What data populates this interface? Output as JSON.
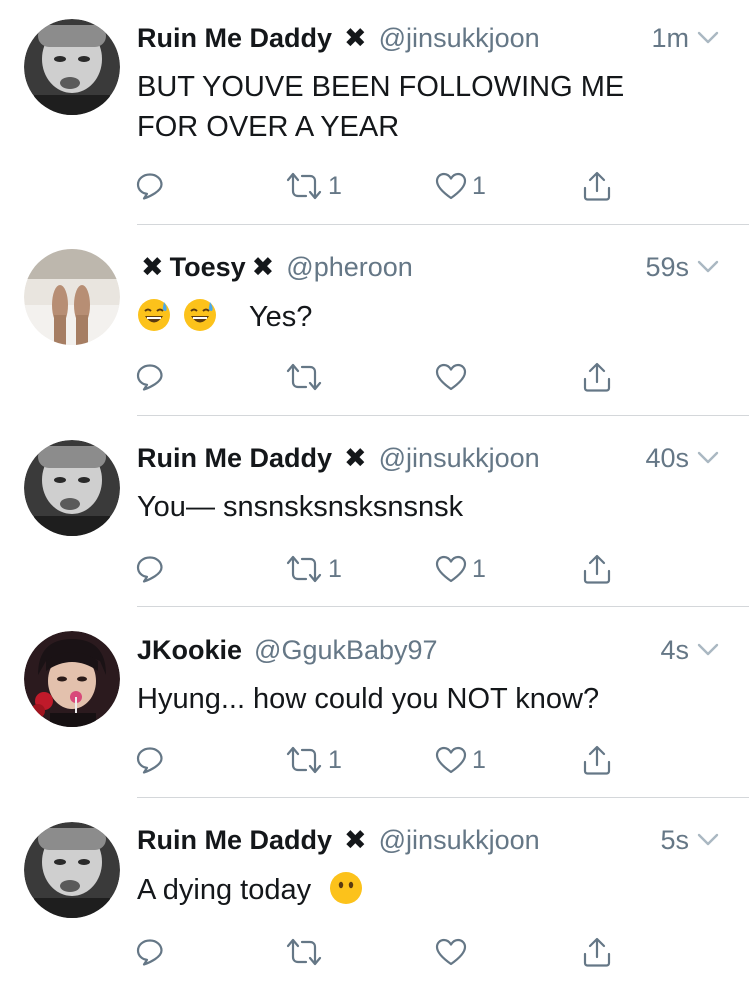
{
  "tweets": [
    {
      "name": "Ruin Me Daddy",
      "lead_x": false,
      "trail_x": true,
      "handle": "@jinsukkjoon",
      "time": "1m",
      "text": "BUT YOUVE BEEN FOLLOWING ME FOR OVER A YEAR",
      "emoji_before": [],
      "emoji_after": "",
      "retweets": "1",
      "likes": "1",
      "avatar": "bw-face"
    },
    {
      "name": "Toesy",
      "lead_x": true,
      "trail_x": true,
      "handle": "@pheroon",
      "time": "59s",
      "text": "Yes?",
      "emoji_before": [
        "sweat-smile-emoji",
        "sweat-smile-emoji"
      ],
      "emoji_after": "",
      "retweets": "",
      "likes": "",
      "avatar": "feet"
    },
    {
      "name": "Ruin Me Daddy",
      "lead_x": false,
      "trail_x": true,
      "handle": "@jinsukkjoon",
      "time": "40s",
      "text": "You— snsnsksnsksnsnsk",
      "emoji_before": [],
      "emoji_after": "",
      "retweets": "1",
      "likes": "1",
      "avatar": "bw-face"
    },
    {
      "name": "JKookie",
      "lead_x": false,
      "trail_x": false,
      "handle": "@GgukBaby97",
      "time": "4s",
      "text": "Hyung... how could you NOT know?",
      "emoji_before": [],
      "emoji_after": "",
      "retweets": "1",
      "likes": "1",
      "avatar": "color-face"
    },
    {
      "name": "Ruin Me Daddy",
      "lead_x": false,
      "trail_x": true,
      "handle": "@jinsukkjoon",
      "time": "5s",
      "text": "A dying today",
      "emoji_before": [],
      "emoji_after": "no-mouth-emoji",
      "retweets": "",
      "likes": "",
      "avatar": "bw-face"
    }
  ],
  "colors": {
    "text": "#14171a",
    "secondary": "#657786",
    "divider": "#d4d7da",
    "background": "#ffffff"
  }
}
